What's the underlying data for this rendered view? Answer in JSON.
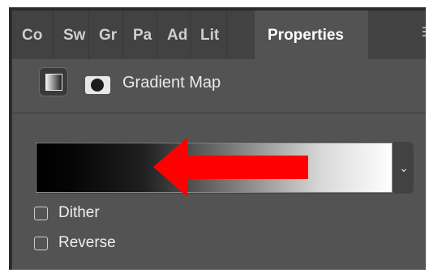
{
  "tabs": [
    {
      "label": "Co"
    },
    {
      "label": "Sw"
    },
    {
      "label": "Gr"
    },
    {
      "label": "Pa"
    },
    {
      "label": "Ad"
    },
    {
      "label": "Lit"
    },
    {
      "label": "Properties"
    }
  ],
  "adjustment": {
    "title": "Gradient Map",
    "icon": "gradient-map-icon",
    "mask_icon": "layer-mask-icon"
  },
  "gradient": {
    "from_color": "#000000",
    "to_color": "#ffffff",
    "dropdown_icon": "chevron-down-icon"
  },
  "annotation": {
    "arrow_color": "#ff0000",
    "direction": "left"
  },
  "options": [
    {
      "label": "Dither",
      "checked": false
    },
    {
      "label": "Reverse",
      "checked": false
    }
  ],
  "colors": {
    "panel": "#535353",
    "tabbar": "#424242",
    "text": "#e9e9e9"
  }
}
